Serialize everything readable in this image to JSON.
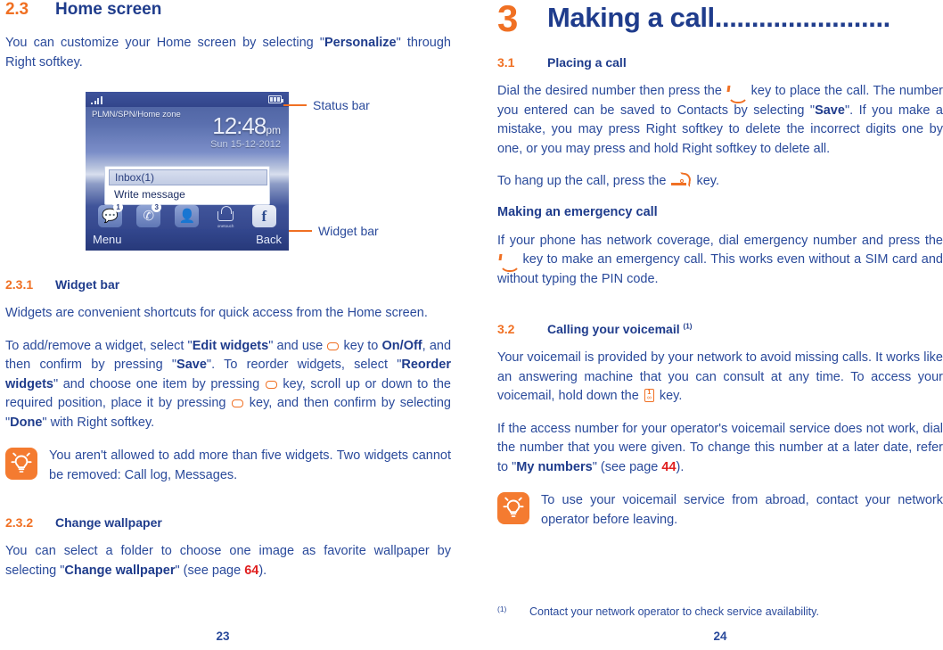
{
  "left_page": {
    "folio": "23",
    "section_2_3": {
      "number": "2.3",
      "title": "Home screen",
      "intro_p1_a": "You can customize your Home screen by selecting \"",
      "intro_p1_b": "Personalize",
      "intro_p1_c": "\" through Right softkey."
    },
    "figure": {
      "callouts": {
        "status_bar": "Status bar",
        "widget_bar": "Widget bar"
      },
      "phone_screen": {
        "operator": "PLMN/SPN/Home zone",
        "time": "12:48",
        "ampm": "pm",
        "date": "Sun 15-12-2012",
        "widget_panel_item_1": "Inbox(1)",
        "widget_panel_item_2": "Write message",
        "softkey_left": "Menu",
        "softkey_right": "Back",
        "icons": [
          {
            "name": "messages-icon",
            "badge": "1"
          },
          {
            "name": "call-log-icon",
            "badge": "3"
          },
          {
            "name": "contacts-icon",
            "badge": ""
          },
          {
            "name": "one-touch-store-icon",
            "label": "onetouch",
            "badge": ""
          },
          {
            "name": "facebook-icon",
            "glyph": "f",
            "badge": ""
          }
        ]
      }
    },
    "section_2_3_1": {
      "number": "2.3.1",
      "title": "Widget bar",
      "p1": "Widgets are convenient shortcuts for quick access from the Home screen.",
      "p2_parts": {
        "a": "To add/remove a widget, select \"",
        "b": "Edit widgets",
        "c": "\" and use ",
        "d": " key to ",
        "e": "On/Off",
        "f": ", and then confirm by pressing \"",
        "g": "Save",
        "h": "\". To reorder widgets, select \"",
        "i": "Reorder widgets",
        "j": "\" and choose one item by pressing ",
        "k": " key, scroll up or down to the required position, place it by pressing ",
        "l": " key, and then confirm by selecting \"",
        "m": "Done",
        "n": "\" with Right softkey."
      },
      "tip": "You aren't allowed to add more than five widgets. Two widgets cannot be removed: Call log, Messages."
    },
    "section_2_3_2": {
      "number": "2.3.2",
      "title": "Change wallpaper",
      "p1_a": "You can select a folder to choose one image as favorite wallpaper by selecting \"",
      "p1_b": "Change wallpaper",
      "p1_c": "\" (see page ",
      "p1_page": "64",
      "p1_d": ")."
    }
  },
  "right_page": {
    "folio": "24",
    "chapter": {
      "number": "3",
      "title": "Making a call",
      "dots": "........................"
    },
    "section_3_1": {
      "number": "3.1",
      "title": "Placing a call",
      "p1_a": "Dial the desired number then press the ",
      "p1_b": " key to place the call. The number you entered can be saved to Contacts by selecting \"",
      "p1_c": "Save",
      "p1_d": "\".  If you make a mistake, you may press Right softkey to delete the incorrect digits one by one, or you may press and hold Right softkey to delete all.",
      "p2_a": "To hang up the call, press the ",
      "p2_b": " key.",
      "subheading": "Making an emergency call",
      "p3_a": "If your phone has network coverage, dial emergency number and press the ",
      "p3_b": " key to make an emergency call. This works even without a SIM card and without typing the PIN code."
    },
    "section_3_2": {
      "number": "3.2",
      "title": "Calling your voicemail",
      "footnote_mark": "(1)",
      "p1_a": "Your voicemail is provided by your network to avoid missing calls. It works like an answering machine that you can consult at any time. To access your voicemail, hold down the ",
      "p1_b": " key.",
      "p2_a": "If the access number for your operator's voicemail service does not work, dial the number that you were given. To change this number at a later date, refer to \"",
      "p2_b": "My numbers",
      "p2_c": "\" (see page ",
      "p2_page": "44",
      "p2_d": ").",
      "tip": "To use your voicemail service from abroad, contact your network operator before leaving."
    },
    "footnote": {
      "mark": "(1)",
      "text": "Contact your network operator to check service availability."
    }
  },
  "voicemail_key_glyph": {
    "top": "1",
    "bottom": "∞"
  },
  "colors": {
    "heading_blue": "#1F3C8C",
    "body_blue": "#2A4A9B",
    "accent_orange": "#F07023",
    "tip_orange": "#F47B30",
    "page_ref_red": "#E02020"
  }
}
